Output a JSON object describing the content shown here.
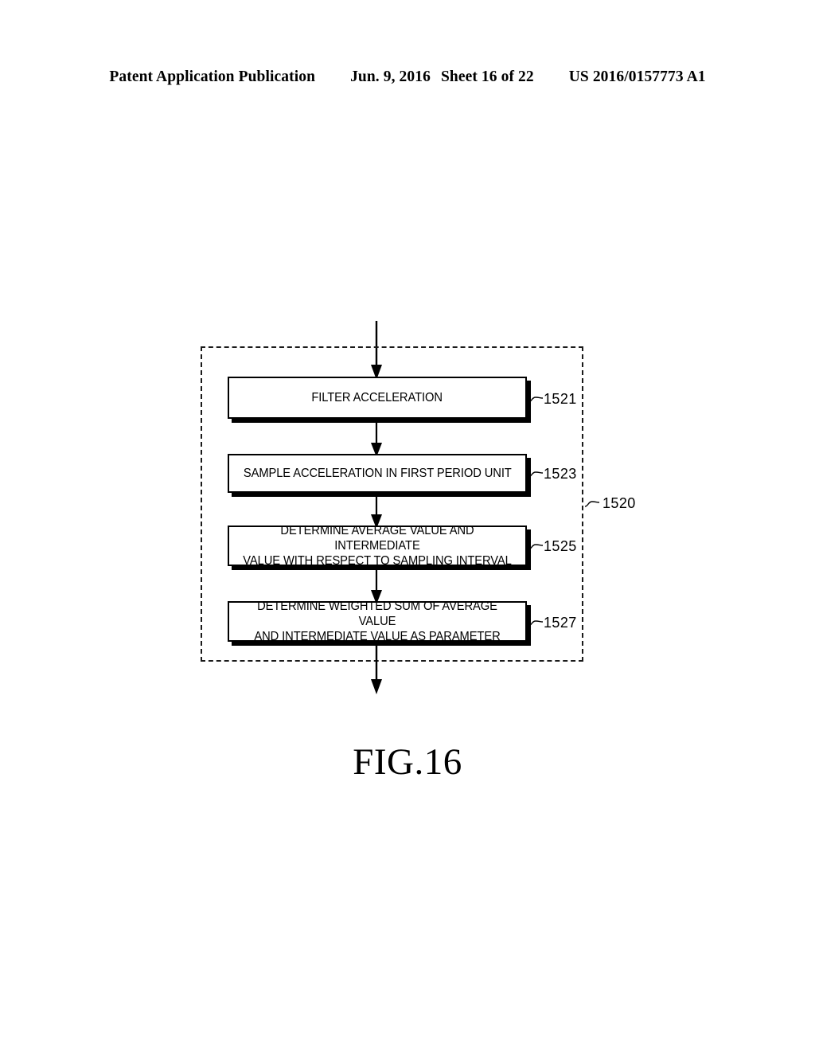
{
  "header": {
    "publication": "Patent Application Publication",
    "date": "Jun. 9, 2016",
    "sheet": "Sheet 16 of 22",
    "document_number": "US 2016/0157773 A1"
  },
  "figure": {
    "caption": "FIG.16",
    "group": {
      "ref": "1520",
      "style": "dashed"
    },
    "steps": [
      {
        "ref": "1521",
        "text": "FILTER ACCELERATION",
        "lines": 1
      },
      {
        "ref": "1523",
        "text": "SAMPLE ACCELERATION IN FIRST PERIOD UNIT",
        "lines": 1
      },
      {
        "ref": "1525",
        "text": "DETERMINE AVERAGE VALUE AND INTERMEDIATE\nVALUE WITH RESPECT TO SAMPLING INTERVAL",
        "lines": 2
      },
      {
        "ref": "1527",
        "text": "DETERMINE WEIGHTED SUM OF AVERAGE VALUE\nAND INTERMEDIATE VALUE AS PARAMETER",
        "lines": 2
      }
    ],
    "connectors": [
      {
        "name": "entry-arrow",
        "from": "above",
        "to": "1521"
      },
      {
        "name": "arrow-1521-1523",
        "from": "1521",
        "to": "1523"
      },
      {
        "name": "arrow-1523-1525",
        "from": "1523",
        "to": "1525"
      },
      {
        "name": "arrow-1525-1527",
        "from": "1525",
        "to": "1527"
      },
      {
        "name": "exit-arrow",
        "from": "1527",
        "to": "below"
      }
    ]
  },
  "colors": {
    "ink": "#000000",
    "paper": "#ffffff",
    "dashed": "#1a1a1a"
  }
}
